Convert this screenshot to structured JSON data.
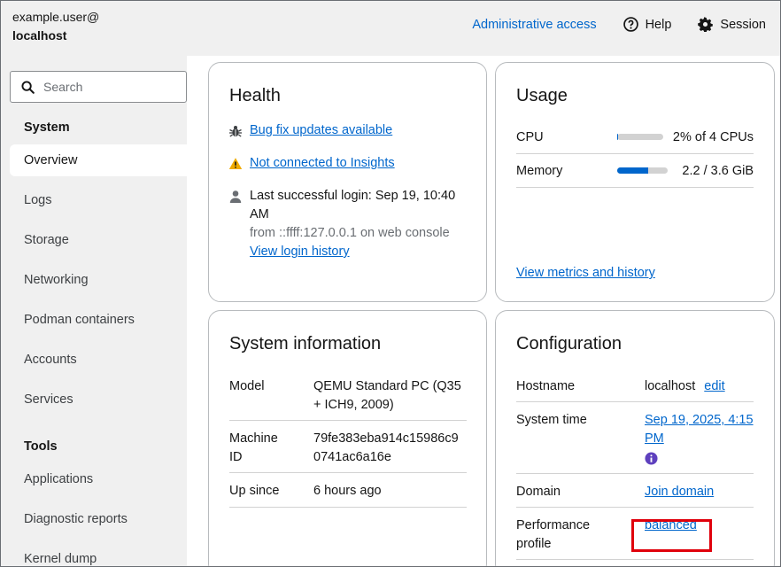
{
  "header": {
    "user": "example.user@",
    "host": "localhost",
    "admin_access": "Administrative access",
    "help": "Help",
    "session": "Session"
  },
  "sidebar": {
    "search_placeholder": "Search",
    "system_group": "System",
    "items": [
      "Overview",
      "Logs",
      "Storage",
      "Networking",
      "Podman containers",
      "Accounts",
      "Services"
    ],
    "tools_group": "Tools",
    "tools_items": [
      "Applications",
      "Diagnostic reports",
      "Kernel dump"
    ]
  },
  "health": {
    "title": "Health",
    "bug_fix": "Bug fix updates available",
    "insights": "Not connected to Insights",
    "login_line1": "Last successful login: Sep 19, 10:40",
    "login_line2": "AM",
    "login_from": "from ::ffff:127.0.0.1 on web console",
    "login_history": "View login history"
  },
  "usage": {
    "title": "Usage",
    "cpu_label": "CPU",
    "cpu_value": "2% of 4 CPUs",
    "cpu_fraction": 0.02,
    "memory_label": "Memory",
    "memory_value": "2.2 / 3.6 GiB",
    "memory_fraction": 0.61,
    "metrics_link": "View metrics and history"
  },
  "sysinfo": {
    "title": "System information",
    "model_label": "Model",
    "model_value_1": "QEMU Standard PC (Q35",
    "model_value_2": "+ ICH9, 2009)",
    "machine_label_1": "Machine",
    "machine_label_2": "ID",
    "machine_value_1": "79fe383eba914c15986c9",
    "machine_value_2": "0741ac6a16e",
    "up_label": "Up since",
    "up_value": "6 hours ago"
  },
  "config": {
    "title": "Configuration",
    "hostname_label": "Hostname",
    "hostname_value": "localhost",
    "hostname_edit": "edit",
    "time_label": "System time",
    "time_value_1": "Sep 19, 2025, 4:15",
    "time_value_2": "PM",
    "domain_label": "Domain",
    "domain_value": "Join domain",
    "perf_label_1": "Performance",
    "perf_label_2": "profile",
    "perf_value": "balanced"
  },
  "colors": {
    "link": "#0066cc",
    "warning": "#f0ab00",
    "highlight": "#e0000b",
    "info_icon": "#5e40be"
  }
}
